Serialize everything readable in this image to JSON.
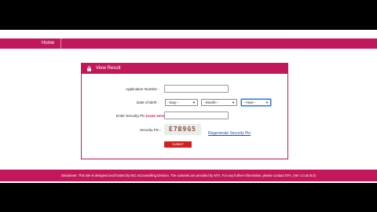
{
  "nav": {
    "home_label": "Home"
  },
  "panel": {
    "title": "View Result"
  },
  "form": {
    "application_number_label": "Application Number :",
    "dob_label": "Date of Birth :",
    "day_value": "--Day--",
    "month_value": "--Month--",
    "year_value": "--Year--",
    "security_pin_entry_label_prefix": "Enter Security Pin",
    "security_pin_case_note": "(case sensitive)",
    "security_pin_entry_label_suffix": ":",
    "security_pin_label": "Security Pin :",
    "captcha_text": "E7B9G5",
    "regenerate_link": "Regenerate Security Pin",
    "submit_label": "SUBMIT"
  },
  "footer": {
    "disclaimer": "Disclaimer: This site is designed and hosted by NIC eCounselling Division. The contents are provided by NTA. For any further information, please contact NTA. (Ver 1.0.40.8.0)"
  },
  "colors": {
    "brand": "#c2185b",
    "submit": "#d21f1f",
    "link": "#1a4fb5"
  }
}
